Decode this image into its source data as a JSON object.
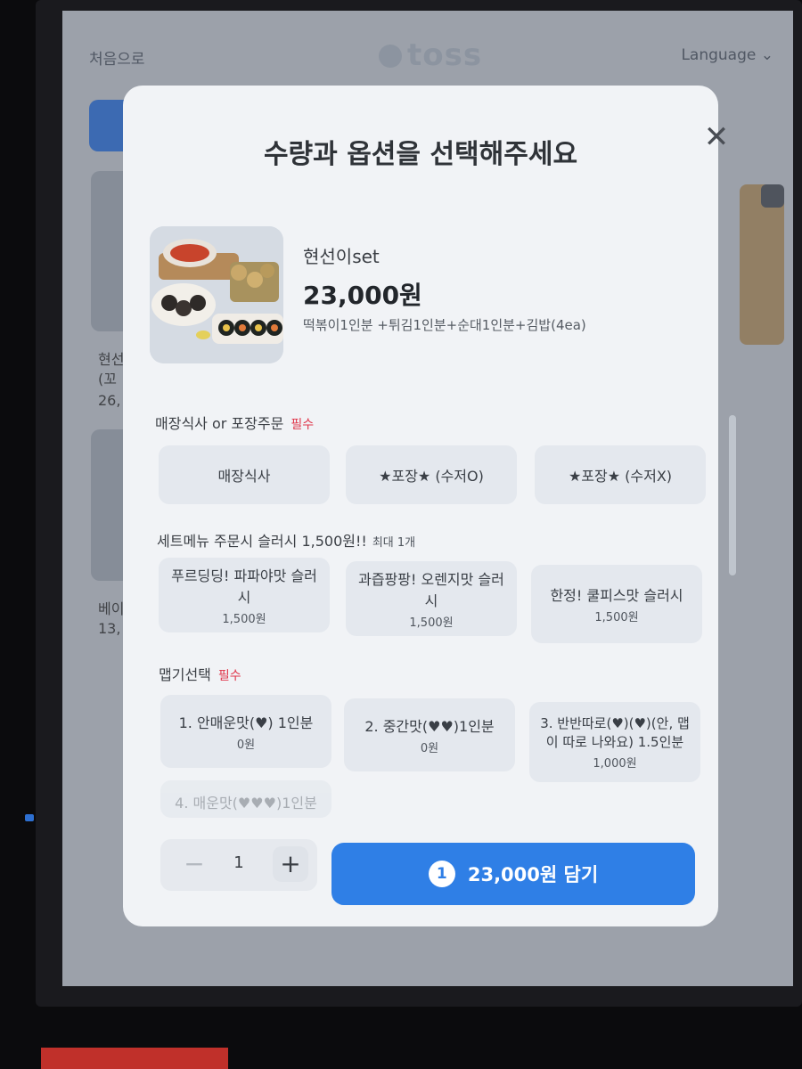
{
  "background": {
    "home_label": "처음으로",
    "logo_text": "toss",
    "language_label": "Language",
    "language_chevron": "⌄",
    "card1_name": "현선",
    "card1_sub": "(꼬",
    "card1_price": "26,",
    "card2_name": "베이",
    "card2_price": "13,"
  },
  "modal": {
    "title": "수량과 옵션을 선택해주세요",
    "close_glyph": "✕",
    "product": {
      "name": "현선이set",
      "price": "23,000원",
      "description": "떡볶이1인분 +튀김1인분+순대1인분+김밥(4ea)"
    },
    "sections": [
      {
        "title": "매장식사 or 포장주문",
        "badge": "필수",
        "options": [
          {
            "label": "매장식사"
          },
          {
            "label": "★포장★ (수저O)"
          },
          {
            "label": "★포장★ (수저X)"
          }
        ]
      },
      {
        "title": "세트메뉴 주문시 슬러시 1,500원!!",
        "badge": "최대 1개",
        "options": [
          {
            "label": "푸르딩딩! 파파야맛 슬러시",
            "price": "1,500원"
          },
          {
            "label": "과즙팡팡! 오렌지맛 슬러시",
            "price": "1,500원"
          },
          {
            "label": "한정! 쿨피스맛 슬러시",
            "price": "1,500원"
          }
        ]
      },
      {
        "title": "맵기선택",
        "badge": "필수",
        "options": [
          {
            "label": "1. 안매운맛(♥) 1인분",
            "price": "0원"
          },
          {
            "label": "2. 중간맛(♥♥)1인분",
            "price": "0원"
          },
          {
            "label": "3. 반반따로(♥)(♥)(안, 맵이 따로 나와요) 1.5인분",
            "price": "1,000원"
          },
          {
            "label": "4. 매운맛(♥♥♥)1인분"
          }
        ]
      }
    ],
    "quantity": {
      "minus": "−",
      "value": "1",
      "plus": "+"
    },
    "add_button": {
      "count": "1",
      "label": "23,000원 담기"
    }
  }
}
